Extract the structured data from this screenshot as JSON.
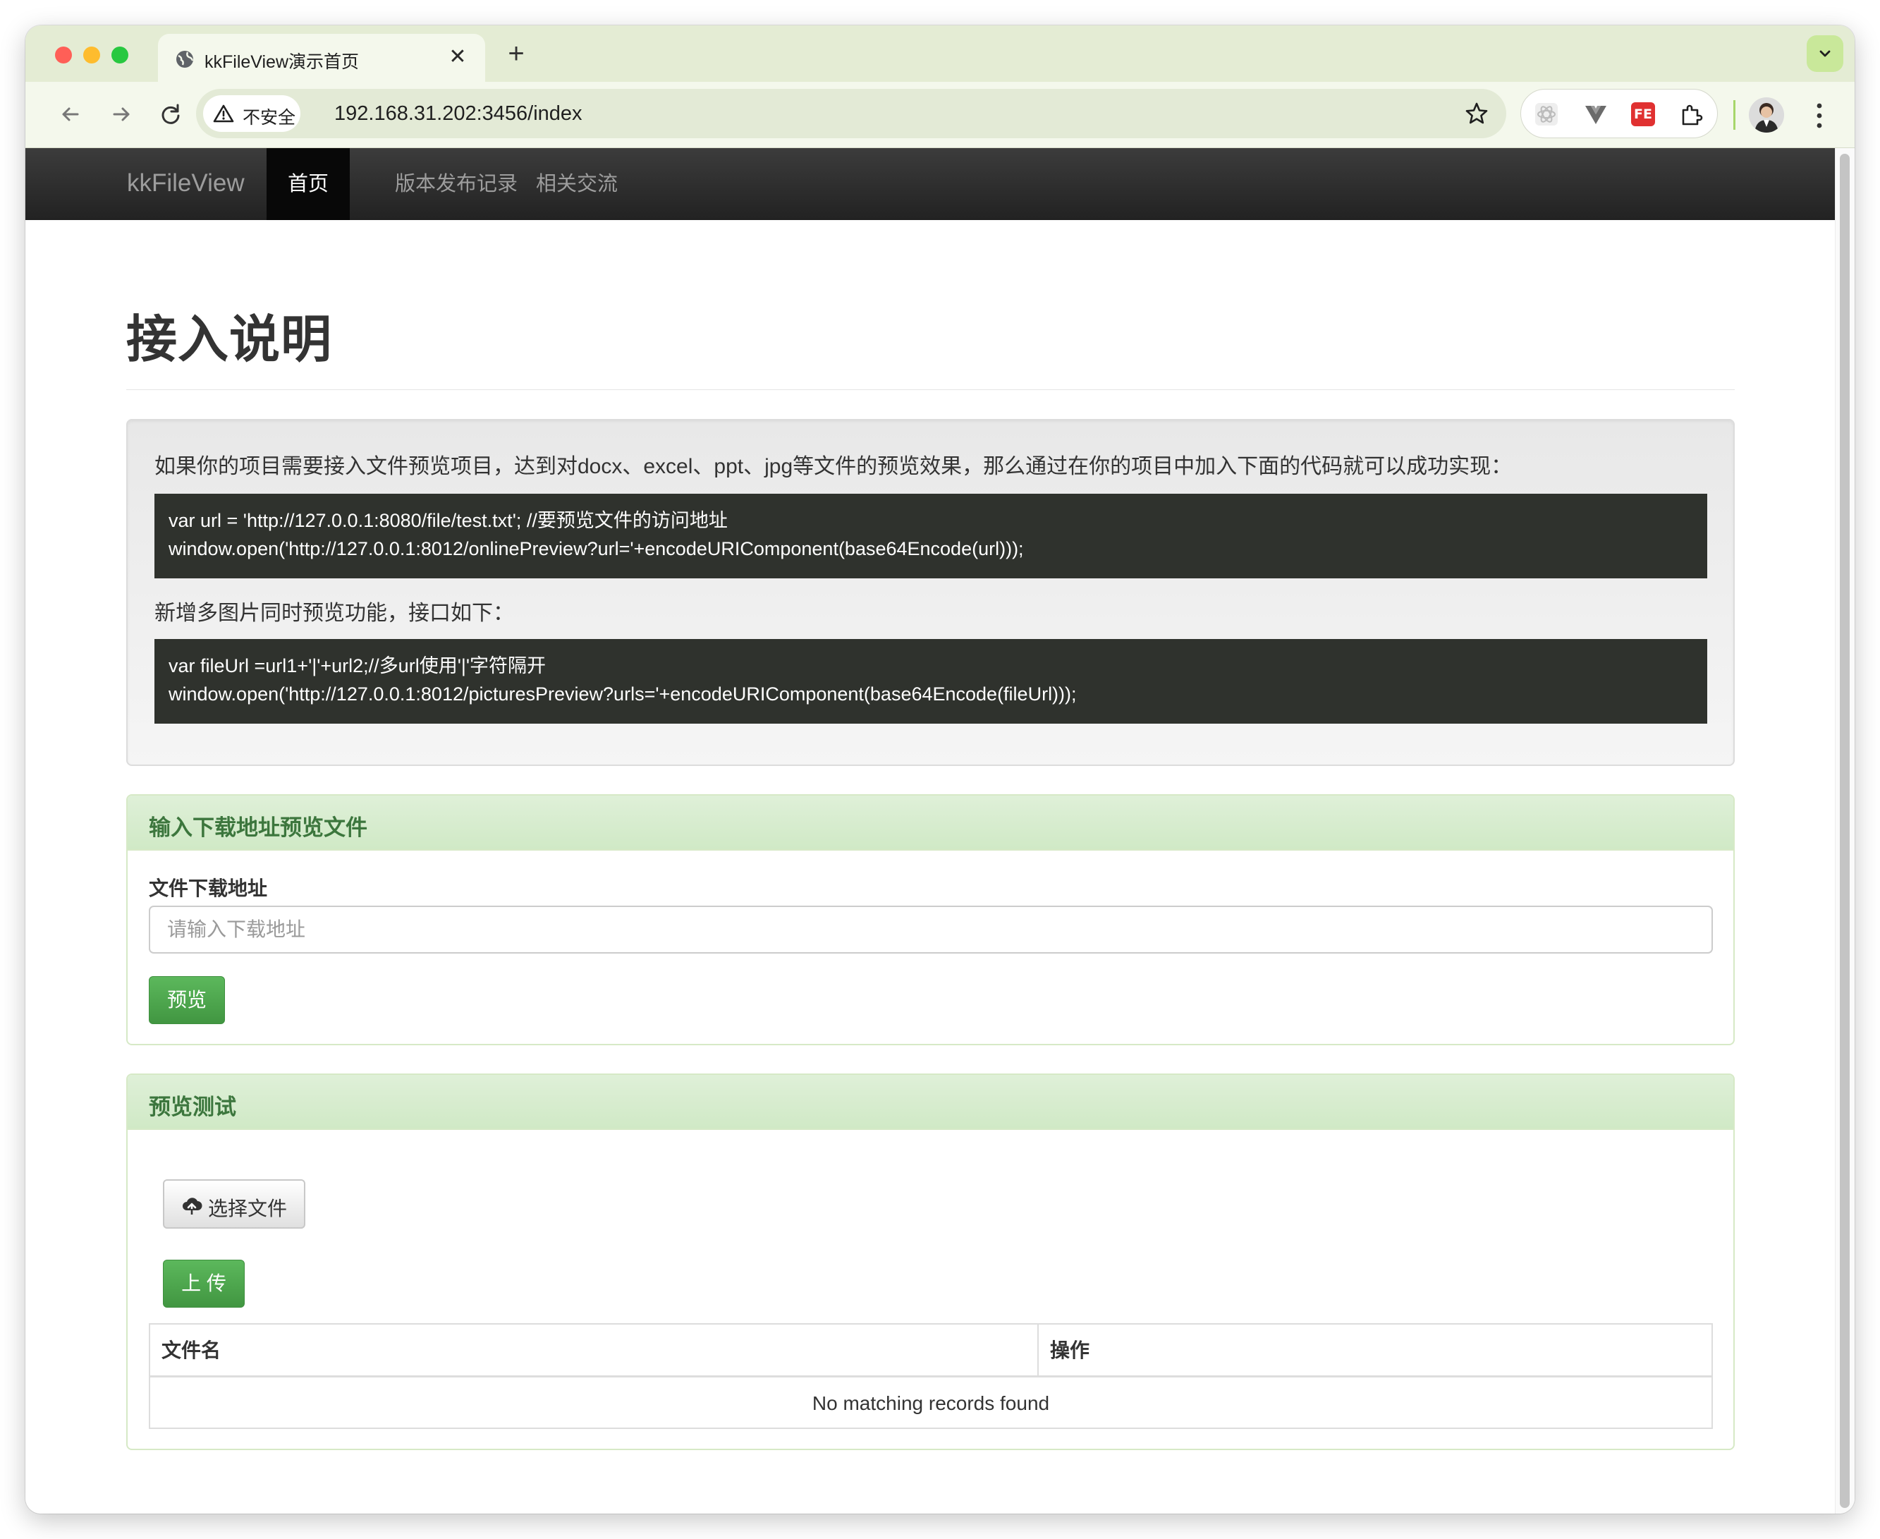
{
  "browser": {
    "tab_title": "kkFileView演示首页",
    "close_glyph": "✕",
    "new_tab_glyph": "+",
    "security_label": "不安全",
    "url": "192.168.31.202:3456/index",
    "extension_fe_label": "FE"
  },
  "site_nav": {
    "brand": "kkFileView",
    "links": [
      {
        "label": "首页",
        "active": true
      },
      {
        "label": "版本发布记录",
        "active": false
      },
      {
        "label": "相关交流",
        "active": false
      }
    ]
  },
  "intro": {
    "title": "接入说明",
    "paragraph1": "如果你的项目需要接入文件预览项目，达到对docx、excel、ppt、jpg等文件的预览效果，那么通过在你的项目中加入下面的代码就可以成功实现：",
    "code1": [
      "var url = 'http://127.0.0.1:8080/file/test.txt'; //要预览文件的访问地址",
      "window.open('http://127.0.0.1:8012/onlinePreview?url='+encodeURIComponent(base64Encode(url)));"
    ],
    "paragraph2": "新增多图片同时预览功能，接口如下：",
    "code2": [
      "var fileUrl =url1+'|'+url2;//多url使用'|'字符隔开",
      "window.open('http://127.0.0.1:8012/picturesPreview?urls='+encodeURIComponent(base64Encode(fileUrl)));"
    ]
  },
  "url_panel": {
    "heading": "输入下载地址预览文件",
    "field_label": "文件下载地址",
    "input_value": "",
    "input_placeholder": "请输入下载地址",
    "preview_button": "预览"
  },
  "test_panel": {
    "heading": "预览测试",
    "choose_file_button": "选择文件",
    "upload_button": "上 传",
    "table": {
      "columns": [
        "文件名",
        "操作"
      ],
      "empty_message": "No matching records found"
    }
  },
  "colors": {
    "tab_strip": "#e4ecd4",
    "navbar": "#222222",
    "panel_heading_text": "#3c763d",
    "success_button": "#5cb85c",
    "code_background": "#2f322d"
  }
}
